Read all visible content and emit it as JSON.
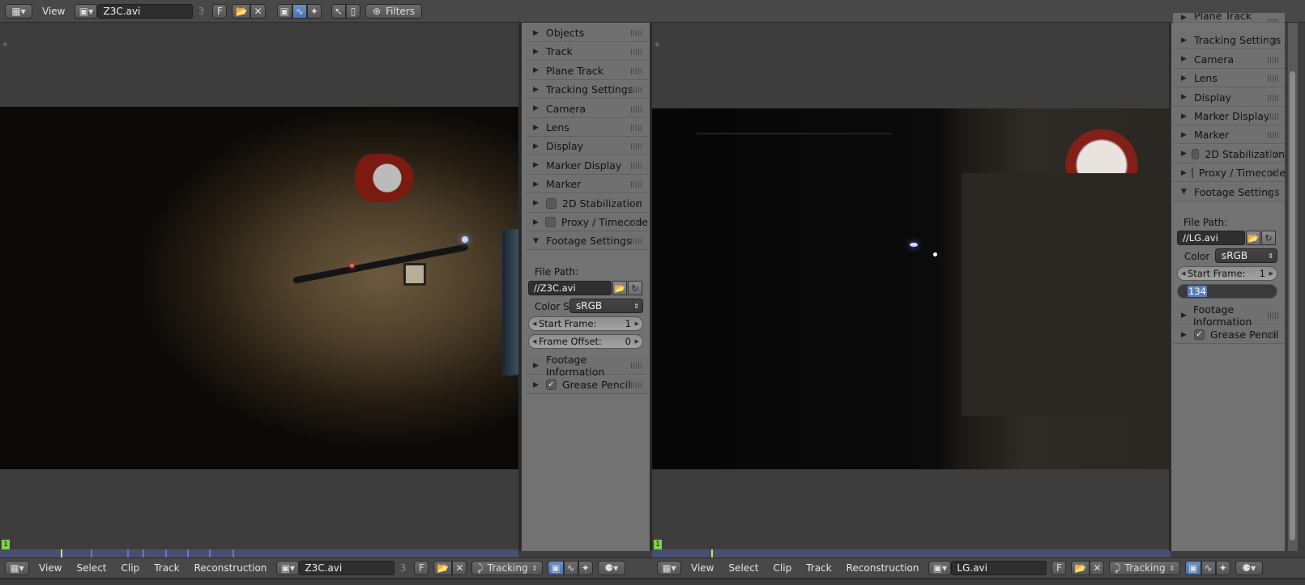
{
  "top_header": {
    "view_label": "View",
    "clip_name": "Z3C.avi",
    "users": "3",
    "fake_user": "F",
    "filters_label": "Filters"
  },
  "left_panel": {
    "rows": [
      {
        "label": "Objects"
      },
      {
        "label": "Track"
      },
      {
        "label": "Plane Track"
      },
      {
        "label": "Tracking Settings"
      },
      {
        "label": "Camera"
      },
      {
        "label": "Lens"
      },
      {
        "label": "Display"
      },
      {
        "label": "Marker Display"
      },
      {
        "label": "Marker"
      },
      {
        "label": "2D Stabilization"
      },
      {
        "label": "Proxy / Timecode"
      },
      {
        "label": "Footage Settings"
      }
    ],
    "file_path_label": "File Path:",
    "file_path": "//Z3C.avi",
    "color_label": "Color S",
    "color_value": "sRGB",
    "start_frame_label": "Start Frame:",
    "start_frame": "1",
    "frame_offset_label": "Frame Offset:",
    "frame_offset": "0",
    "footage_info": "Footage Information",
    "grease_pencil": "Grease Pencil"
  },
  "right_panel": {
    "rows": [
      {
        "label": "Plane Track"
      },
      {
        "label": "Tracking Settings"
      },
      {
        "label": "Camera"
      },
      {
        "label": "Lens"
      },
      {
        "label": "Display"
      },
      {
        "label": "Marker Display"
      },
      {
        "label": "Marker"
      },
      {
        "label": "2D Stabilization"
      },
      {
        "label": "Proxy / Timecode"
      },
      {
        "label": "Footage Settings"
      }
    ],
    "file_path_label": "File Path:",
    "file_path": "//LG.avi",
    "color_label": "Color",
    "color_value": "sRGB",
    "start_frame_label": "Start Frame:",
    "start_frame": "1",
    "editing_value": "134",
    "footage_info": "Footage Information",
    "grease_pencil": "Grease Pencil"
  },
  "left_bottom": {
    "frame": "1",
    "menus": [
      "View",
      "Select",
      "Clip",
      "Track",
      "Reconstruction"
    ],
    "clip_name": "Z3C.avi",
    "users": "3",
    "fake_user": "F",
    "mode": "Tracking"
  },
  "right_bottom": {
    "frame": "1",
    "menus": [
      "View",
      "Select",
      "Clip",
      "Track",
      "Reconstruction"
    ],
    "clip_name": "LG.avi",
    "fake_user": "F",
    "mode": "Tracking"
  },
  "colors": {
    "header": "#484848",
    "panel": "#727272",
    "timeline": "#4a4f6e",
    "frame_marker": "#7fd14a"
  }
}
